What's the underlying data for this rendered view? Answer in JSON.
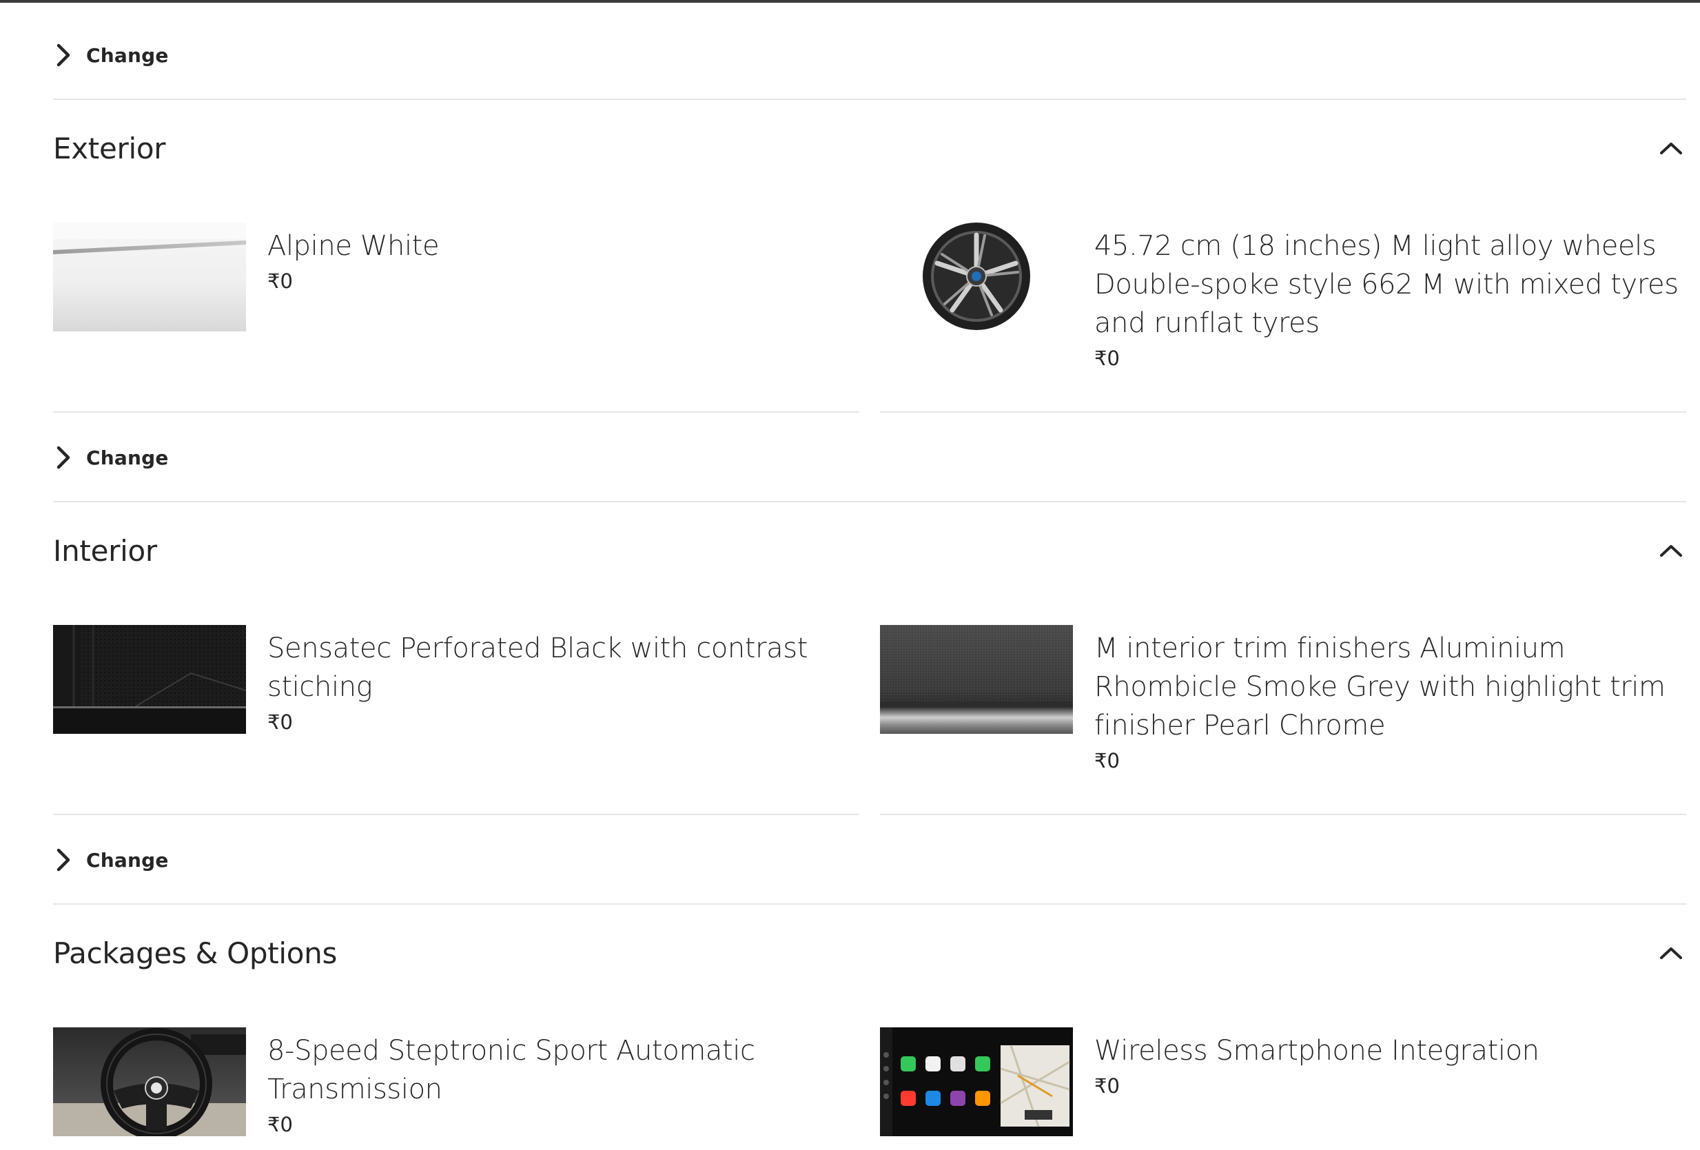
{
  "change_label": "Change",
  "sections": {
    "exterior": {
      "title": "Exterior",
      "items": [
        {
          "name": "Alpine White",
          "price": "₹0"
        },
        {
          "name": "45.72 cm (18 inches) M light alloy wheels Double-spoke style 662 M with mixed tyres and runflat tyres",
          "price": "₹0"
        }
      ]
    },
    "interior": {
      "title": "Interior",
      "items": [
        {
          "name": "Sensatec Perforated Black with contrast stiching",
          "price": "₹0"
        },
        {
          "name": "M interior trim finishers Aluminium Rhombicle Smoke Grey with highlight trim finisher Pearl Chrome",
          "price": "₹0"
        }
      ]
    },
    "packages": {
      "title": "Packages & Options",
      "items": [
        {
          "name": "8-Speed Steptronic Sport Automatic Transmission",
          "price": "₹0"
        },
        {
          "name": "Wireless Smartphone Integration",
          "price": "₹0"
        }
      ]
    }
  },
  "icons": {
    "change": "chevron-right-icon",
    "collapse": "chevron-up-icon"
  },
  "colors": {
    "text": "#262626",
    "divider": "#e6e6e6",
    "top_rule": "#3c3c3c"
  }
}
